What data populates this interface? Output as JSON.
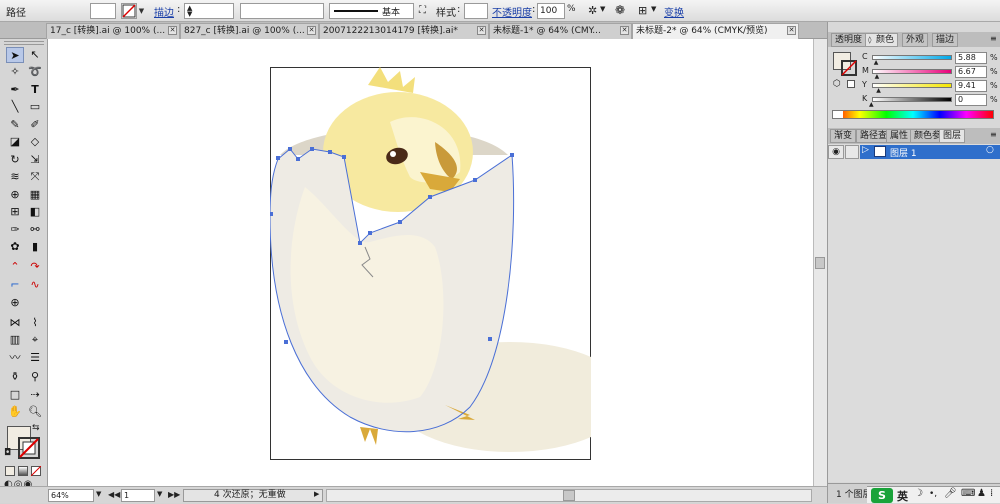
{
  "control_bar": {
    "selection_label": "路径",
    "stroke_label": "描边",
    "stroke_style_label": "基本",
    "style_label": "样式",
    "opacity_label": "不透明度",
    "opacity_value": "100",
    "opacity_unit": "%",
    "transform_label": "变换"
  },
  "tabs": [
    {
      "label": "17_c [转换].ai @ 100% (...",
      "active": false
    },
    {
      "label": "827_c [转换].ai @ 100% (...",
      "active": false
    },
    {
      "label": "2007122213014179 [转换].ai*",
      "active": false
    },
    {
      "label": "未标题-1* @ 64% (CMY...",
      "active": false
    },
    {
      "label": "未标题-2* @ 64% (CMYK/预览)",
      "active": true
    }
  ],
  "color_panel": {
    "tabs": [
      "透明度",
      "颜色",
      "外观",
      "描边"
    ],
    "active_tab": "颜色",
    "channels": [
      {
        "name": "C",
        "value": "5.88",
        "pos": 0.06
      },
      {
        "name": "M",
        "value": "6.67",
        "pos": 0.07
      },
      {
        "name": "Y",
        "value": "9.41",
        "pos": 0.09
      },
      {
        "name": "K",
        "value": "0",
        "pos": 0.0
      }
    ],
    "percent": "%"
  },
  "layers_panel": {
    "tabs": [
      "渐变",
      "路径查",
      "属性",
      "颜色参",
      "图层"
    ],
    "active_tab": "图层",
    "layers": [
      {
        "name": "图层 1"
      }
    ],
    "footer_count": "1 个图层"
  },
  "status_bar": {
    "zoom": "64%",
    "page": "1",
    "status_text": "4 次还原；无重做"
  },
  "ime": {
    "label": "英"
  },
  "colors": {
    "fill_swatch": "#f1ece2",
    "layer_selected": "#2f6fcb",
    "path_stroke": "#4a6fd6",
    "chick_yellow": "#f7e9a0",
    "egg_shell": "#eeebe4",
    "egg_cream": "#f7f2e2",
    "shadow": "#f1ecdc",
    "beak": "#d9a93a"
  }
}
